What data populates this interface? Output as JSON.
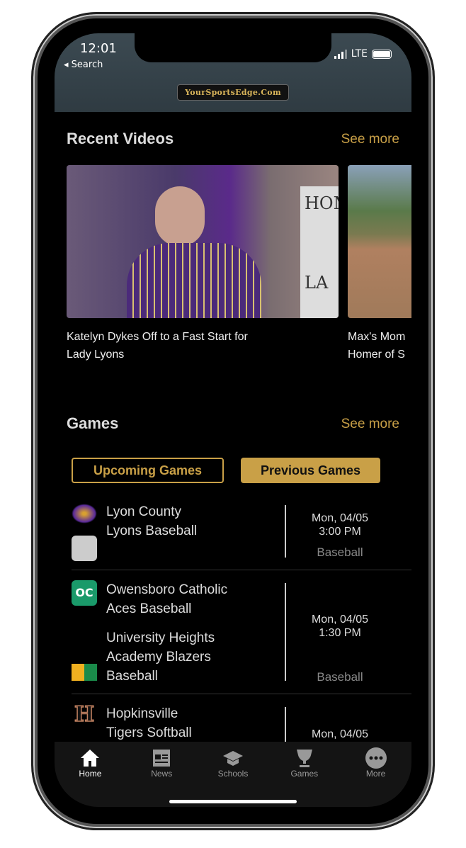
{
  "status_bar": {
    "time": "12:01",
    "back_label": "Search",
    "network": "LTE"
  },
  "header": {
    "logo_text": "YourSportsEdge.Com"
  },
  "recent_videos": {
    "title": "Recent Videos",
    "see_more": "See more",
    "items": [
      {
        "title": "Katelyn Dykes Off to a Fast Start for\nLady Lyons",
        "sign_text": "HOM\n\n\n\nLA"
      },
      {
        "title": "Max's Mom\nHomer of S"
      }
    ]
  },
  "games": {
    "title": "Games",
    "see_more": "See more",
    "tabs": [
      {
        "label": "Upcoming Games",
        "active": false
      },
      {
        "label": "Previous Games",
        "active": true
      }
    ],
    "items": [
      {
        "team1": "Lyon County\nLyons Baseball",
        "team2": "",
        "date": "Mon, 04/05",
        "time": "3:00 PM",
        "sport": "Baseball"
      },
      {
        "team1": "Owensboro Catholic\nAces Baseball",
        "team2": "University Heights\nAcademy Blazers\nBaseball",
        "date": "Mon, 04/05",
        "time": "1:30 PM",
        "sport": "Baseball"
      },
      {
        "team1": "Hopkinsville\nTigers Softball",
        "date": "Mon, 04/05"
      }
    ]
  },
  "tab_bar": {
    "items": [
      {
        "label": "Home",
        "icon": "home-icon",
        "active": true
      },
      {
        "label": "News",
        "icon": "newspaper-icon"
      },
      {
        "label": "Schools",
        "icon": "graduation-cap-icon"
      },
      {
        "label": "Games",
        "icon": "trophy-icon"
      },
      {
        "label": "More",
        "icon": "more-icon"
      }
    ]
  },
  "colors": {
    "accent": "#c9a047",
    "background": "#000000",
    "header": "#35434a"
  }
}
